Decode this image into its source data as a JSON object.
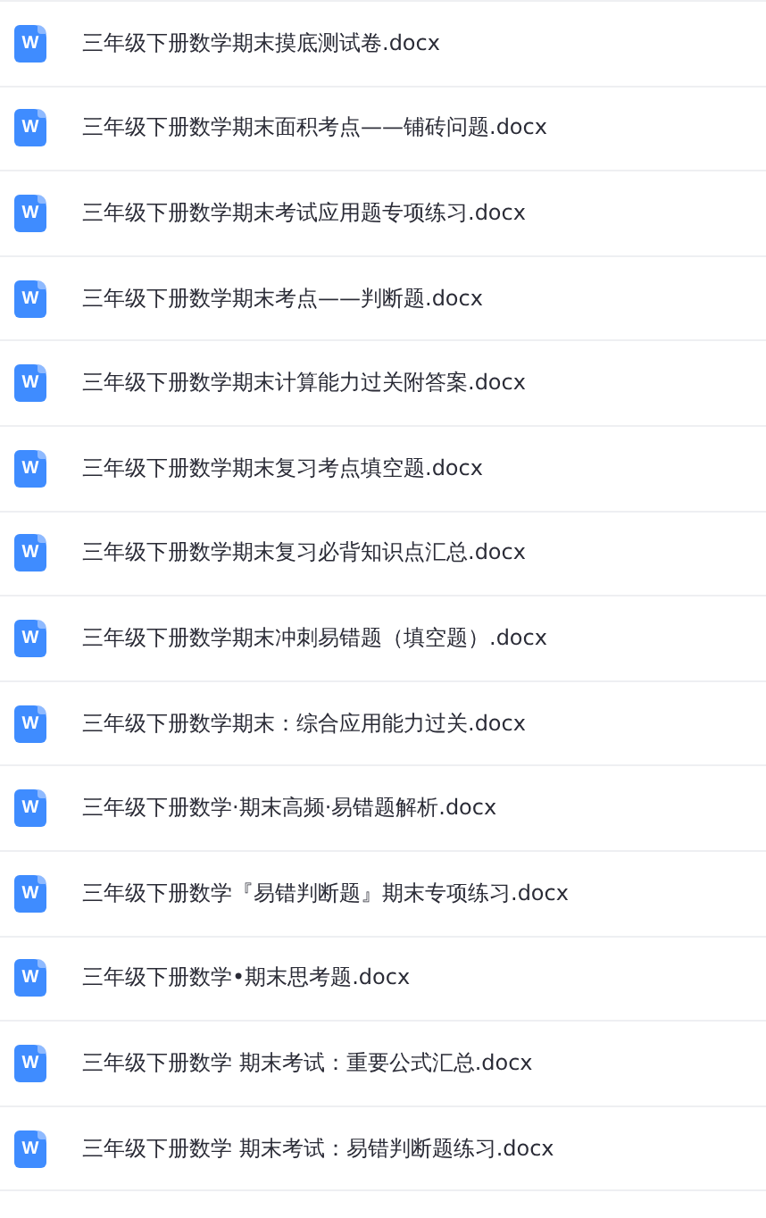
{
  "files": [
    {
      "icon_letter": "W",
      "name": "三年级下册数学期末摸底测试卷.docx"
    },
    {
      "icon_letter": "W",
      "name": "三年级下册数学期末面积考点——铺砖问题.docx"
    },
    {
      "icon_letter": "W",
      "name": "三年级下册数学期末考试应用题专项练习.docx"
    },
    {
      "icon_letter": "W",
      "name": "三年级下册数学期末考点——判断题.docx"
    },
    {
      "icon_letter": "W",
      "name": "三年级下册数学期末计算能力过关附答案.docx"
    },
    {
      "icon_letter": "W",
      "name": "三年级下册数学期末复习考点填空题.docx"
    },
    {
      "icon_letter": "W",
      "name": "三年级下册数学期末复习必背知识点汇总.docx"
    },
    {
      "icon_letter": "W",
      "name": "三年级下册数学期末冲刺易错题（填空题）.docx"
    },
    {
      "icon_letter": "W",
      "name": "三年级下册数学期末：综合应用能力过关.docx"
    },
    {
      "icon_letter": "W",
      "name": "三年级下册数学·期末高频·易错题解析.docx"
    },
    {
      "icon_letter": "W",
      "name": "三年级下册数学『易错判断题』期末专项练习.docx"
    },
    {
      "icon_letter": "W",
      "name": "三年级下册数学•期末思考题.docx"
    },
    {
      "icon_letter": "W",
      "name": "三年级下册数学 期末考试：重要公式汇总.docx"
    },
    {
      "icon_letter": "W",
      "name": "三年级下册数学 期末考试：易错判断题练习.docx"
    }
  ]
}
